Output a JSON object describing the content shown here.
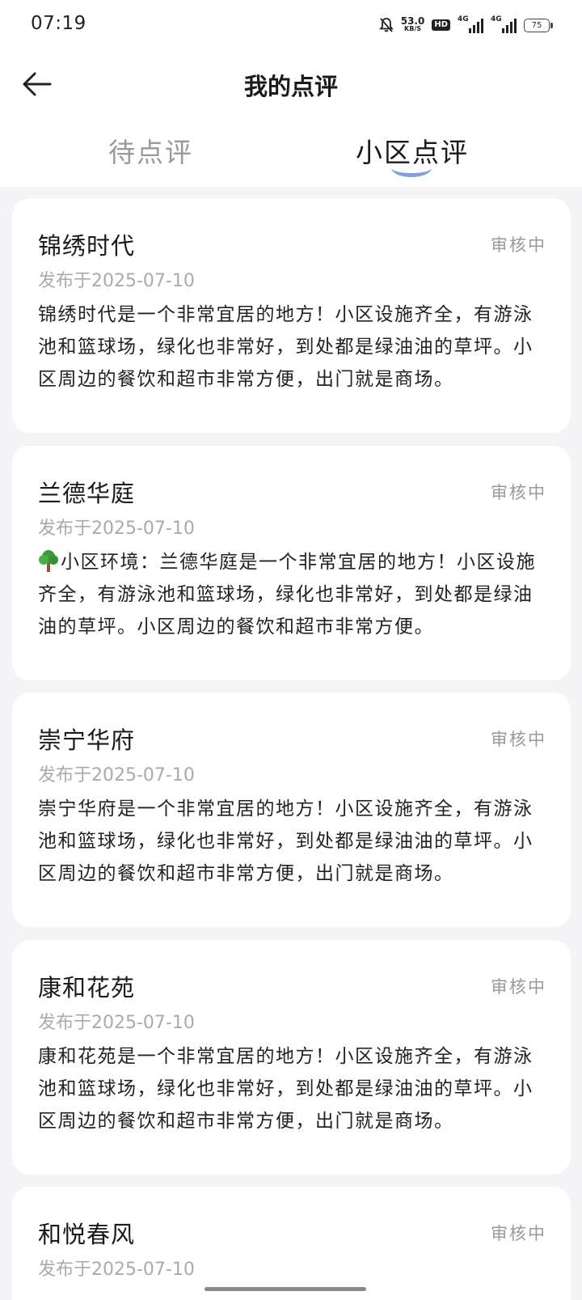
{
  "status_bar": {
    "time": "07:19",
    "speed_value": "53.0",
    "speed_unit": "KB/S",
    "hd_label": "HD",
    "signal1_label": "4G",
    "signal2_label": "4G",
    "battery": "75"
  },
  "header": {
    "title": "我的点评"
  },
  "tabs": [
    {
      "label": "待点评",
      "active": false
    },
    {
      "label": "小区点评",
      "active": true
    }
  ],
  "colors": {
    "tab_indicator": "#6d8fd8",
    "status_text": "#999999"
  },
  "reviews": [
    {
      "name": "锦绣时代",
      "status": "审核中",
      "date": "发布于2025-07-10",
      "text": "锦绣时代是一个非常宜居的地方！小区设施齐全，有游泳池和篮球场，绿化也非常好，到处都是绿油油的草坪。小区周边的餐饮和超市非常方便，出门就是商场。"
    },
    {
      "name": "兰德华庭",
      "status": "审核中",
      "date": "发布于2025-07-10",
      "icon": "tree-icon",
      "text": "小区环境：兰德华庭是一个非常宜居的地方！小区设施齐全，有游泳池和篮球场，绿化也非常好，到处都是绿油油的草坪。小区周边的餐饮和超市非常方便。"
    },
    {
      "name": "崇宁华府",
      "status": "审核中",
      "date": "发布于2025-07-10",
      "text": "崇宁华府是一个非常宜居的地方！小区设施齐全，有游泳池和篮球场，绿化也非常好，到处都是绿油油的草坪。小区周边的餐饮和超市非常方便，出门就是商场。"
    },
    {
      "name": "康和花苑",
      "status": "审核中",
      "date": "发布于2025-07-10",
      "text": "康和花苑是一个非常宜居的地方！小区设施齐全，有游泳池和篮球场，绿化也非常好，到处都是绿油油的草坪。小区周边的餐饮和超市非常方便，出门就是商场。"
    },
    {
      "name": "和悦春风",
      "status": "审核中",
      "date": "发布于2025-07-10",
      "text": ""
    }
  ]
}
